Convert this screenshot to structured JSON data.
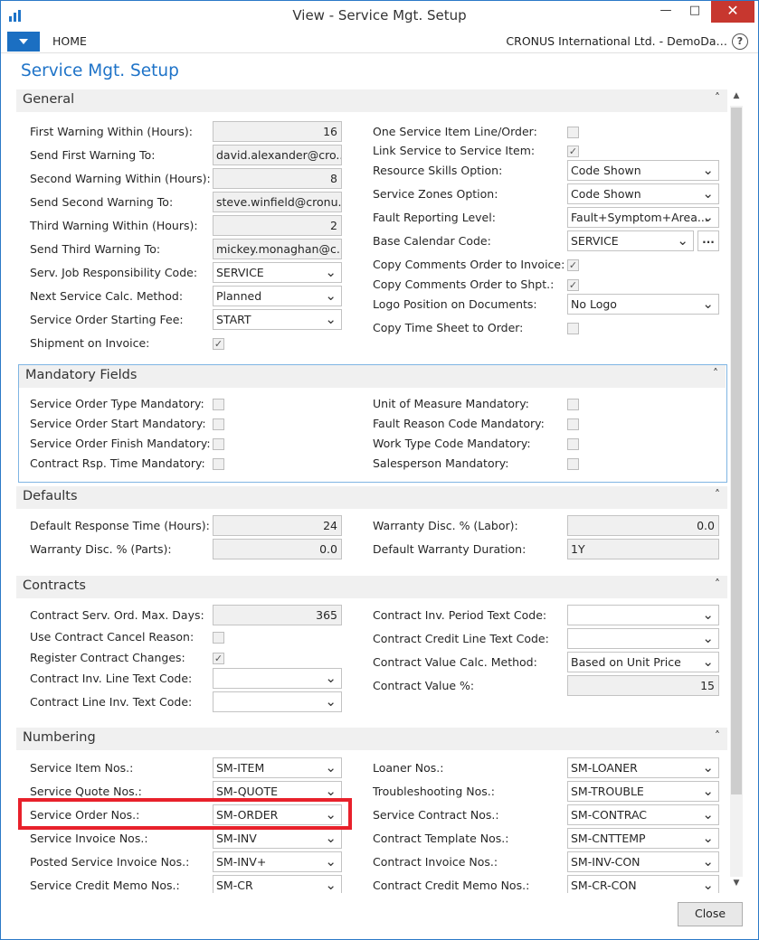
{
  "window": {
    "title": "View - Service Mgt. Setup",
    "minimize": "—",
    "maximize": "□",
    "close": "✕"
  },
  "ribbon": {
    "home_tab": "HOME",
    "company": "CRONUS International Ltd. - DemoDa…",
    "help": "?"
  },
  "page_title": "Service Mgt. Setup",
  "general": {
    "title": "General",
    "left": [
      {
        "label": "First Warning Within (Hours):",
        "value": "16",
        "kind": "num"
      },
      {
        "label": "Send First Warning To:",
        "value": "david.alexander@cro...",
        "kind": "text"
      },
      {
        "label": "Second Warning Within (Hours):",
        "value": "8",
        "kind": "num"
      },
      {
        "label": "Send Second Warning To:",
        "value": "steve.winfield@cronu...",
        "kind": "text"
      },
      {
        "label": "Third Warning Within (Hours):",
        "value": "2",
        "kind": "num"
      },
      {
        "label": "Send Third Warning To:",
        "value": "mickey.monaghan@c...",
        "kind": "text"
      },
      {
        "label": "Serv. Job Responsibility Code:",
        "value": "SERVICE",
        "kind": "dd"
      },
      {
        "label": "Next Service Calc. Method:",
        "value": "Planned",
        "kind": "dd"
      },
      {
        "label": "Service Order Starting Fee:",
        "value": "START",
        "kind": "dd"
      },
      {
        "label": "Shipment on Invoice:",
        "checked": true,
        "kind": "chk"
      }
    ],
    "right": [
      {
        "label": "One Service Item Line/Order:",
        "checked": false,
        "kind": "chk"
      },
      {
        "label": "Link Service to Service Item:",
        "checked": true,
        "kind": "chk"
      },
      {
        "label": "Resource Skills Option:",
        "value": "Code Shown",
        "kind": "dd"
      },
      {
        "label": "Service Zones Option:",
        "value": "Code Shown",
        "kind": "dd"
      },
      {
        "label": "Fault Reporting Level:",
        "value": "Fault+Symptom+Area...",
        "kind": "dd"
      },
      {
        "label": "Base Calendar Code:",
        "value": "SERVICE",
        "kind": "dd-ellip",
        "ellipsis": "..."
      },
      {
        "label": "Copy Comments Order to Invoice:",
        "checked": true,
        "kind": "chk"
      },
      {
        "label": "Copy Comments Order to Shpt.:",
        "checked": true,
        "kind": "chk"
      },
      {
        "label": "Logo Position on Documents:",
        "value": "No Logo",
        "kind": "dd"
      },
      {
        "label": "Copy Time Sheet to Order:",
        "checked": false,
        "kind": "chk"
      }
    ]
  },
  "mandatory": {
    "title": "Mandatory Fields",
    "left": [
      {
        "label": "Service Order Type Mandatory:",
        "checked": false
      },
      {
        "label": "Service Order Start Mandatory:",
        "checked": false
      },
      {
        "label": "Service Order Finish Mandatory:",
        "checked": false
      },
      {
        "label": "Contract Rsp. Time Mandatory:",
        "checked": false
      }
    ],
    "right": [
      {
        "label": "Unit of Measure Mandatory:",
        "checked": false
      },
      {
        "label": "Fault Reason Code Mandatory:",
        "checked": false
      },
      {
        "label": "Work Type Code Mandatory:",
        "checked": false
      },
      {
        "label": "Salesperson Mandatory:",
        "checked": false
      }
    ]
  },
  "defaults": {
    "title": "Defaults",
    "left": [
      {
        "label": "Default Response Time (Hours):",
        "value": "24",
        "kind": "num"
      },
      {
        "label": "Warranty Disc. % (Parts):",
        "value": "0.0",
        "kind": "num"
      }
    ],
    "right": [
      {
        "label": "Warranty Disc. % (Labor):",
        "value": "0.0",
        "kind": "num"
      },
      {
        "label": "Default Warranty Duration:",
        "value": "1Y",
        "kind": "text"
      }
    ]
  },
  "contracts": {
    "title": "Contracts",
    "left": [
      {
        "label": "Contract Serv. Ord.  Max. Days:",
        "value": "365",
        "kind": "num"
      },
      {
        "label": "Use Contract Cancel Reason:",
        "checked": false,
        "kind": "chk"
      },
      {
        "label": "Register Contract Changes:",
        "checked": true,
        "kind": "chk"
      },
      {
        "label": "Contract Inv. Line Text Code:",
        "value": "",
        "kind": "dd"
      },
      {
        "label": "Contract Line Inv. Text Code:",
        "value": "",
        "kind": "dd"
      }
    ],
    "right": [
      {
        "label": "Contract Inv. Period Text Code:",
        "value": "",
        "kind": "dd"
      },
      {
        "label": "Contract Credit Line Text Code:",
        "value": "",
        "kind": "dd"
      },
      {
        "label": "Contract Value Calc. Method:",
        "value": "Based on Unit Price",
        "kind": "dd"
      },
      {
        "label": "Contract Value %:",
        "value": "15",
        "kind": "num"
      }
    ]
  },
  "numbering": {
    "title": "Numbering",
    "left": [
      {
        "label": "Service Item Nos.:",
        "value": "SM-ITEM"
      },
      {
        "label": "Service Quote Nos.:",
        "value": "SM-QUOTE"
      },
      {
        "label": "Service Order Nos.:",
        "value": "SM-ORDER"
      },
      {
        "label": "Service Invoice Nos.:",
        "value": "SM-INV"
      },
      {
        "label": "Posted Service Invoice Nos.:",
        "value": "SM-INV+"
      },
      {
        "label": "Service Credit Memo Nos.:",
        "value": "SM-CR"
      }
    ],
    "right": [
      {
        "label": "Loaner Nos.:",
        "value": "SM-LOANER"
      },
      {
        "label": "Troubleshooting Nos.:",
        "value": "SM-TROUBLE"
      },
      {
        "label": "Service Contract Nos.:",
        "value": "SM-CONTRAC"
      },
      {
        "label": "Contract Template Nos.:",
        "value": "SM-CNTTEMP"
      },
      {
        "label": "Contract Invoice Nos.:",
        "value": "SM-INV-CON"
      },
      {
        "label": "Contract Credit Memo Nos.:",
        "value": "SM-CR-CON"
      }
    ]
  },
  "footer": {
    "close_label": "Close"
  },
  "colors": {
    "accent": "#1e73c8",
    "title_bar_close": "#c7372f",
    "highlight": "#e8212b"
  }
}
